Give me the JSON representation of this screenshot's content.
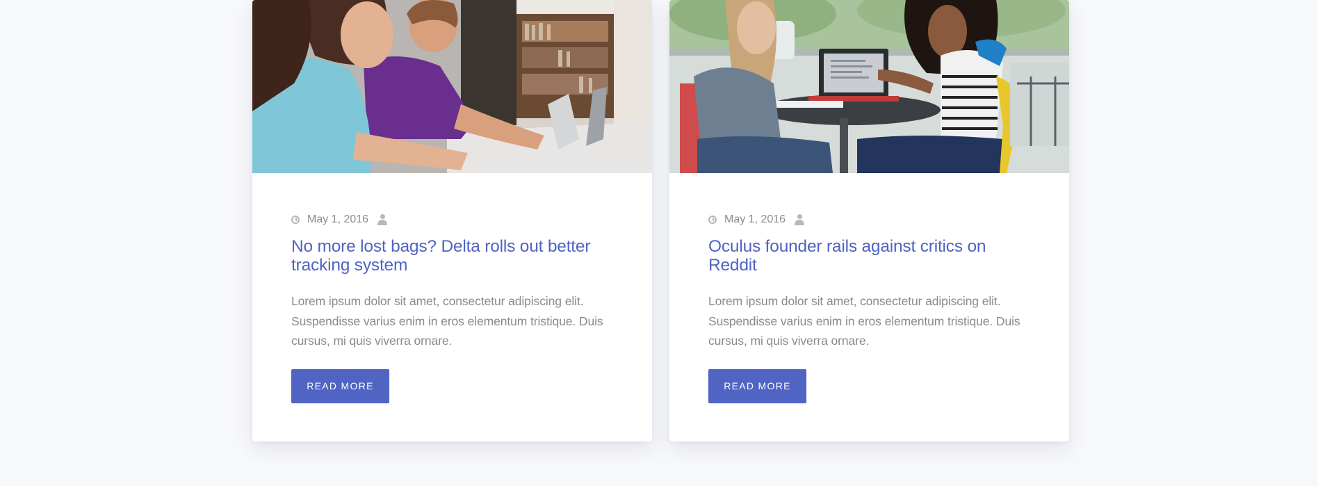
{
  "posts": [
    {
      "image_icon": "photo-students-laptops-library",
      "date": "May 1, 2016",
      "title": "No more lost bags? Delta rolls out better tracking system",
      "excerpt": "Lorem ipsum dolor sit amet, consectetur adipiscing elit. Suspendisse varius enim in eros elementum tristique. Duis cursus, mi quis viverra ornare.",
      "button_label": "READ MORE"
    },
    {
      "image_icon": "photo-students-table-laptop",
      "date": "May 1, 2016",
      "title": "Oculus founder rails against critics on Reddit",
      "excerpt": "Lorem ipsum dolor sit amet, consectetur adipiscing elit. Suspendisse varius enim in eros elementum tristique. Duis cursus, mi quis viverra ornare.",
      "button_label": "READ MORE"
    }
  ],
  "colors": {
    "accent": "#5064c3",
    "title": "#4f63c4",
    "text": "#8a8a8a",
    "background": "#f7f8fb"
  }
}
